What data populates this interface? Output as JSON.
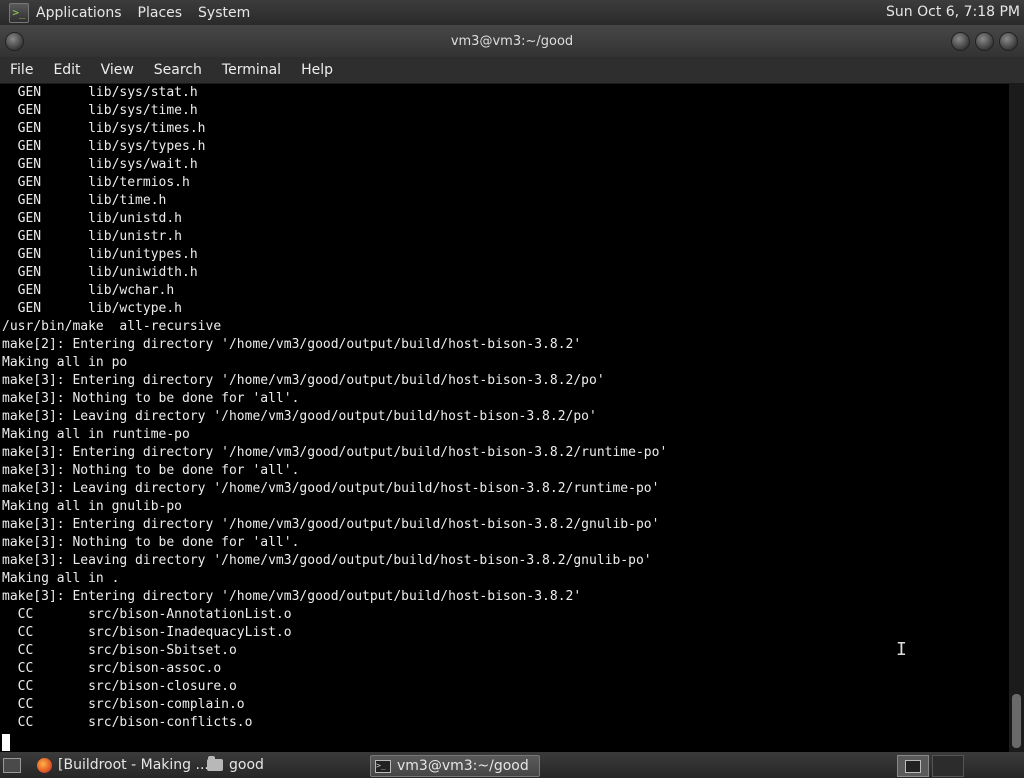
{
  "top_panel": {
    "menus": [
      "Applications",
      "Places",
      "System"
    ],
    "clock": "Sun Oct  6,  7:18 PM"
  },
  "window": {
    "title": "vm3@vm3:~/good"
  },
  "menubar": [
    "File",
    "Edit",
    "View",
    "Search",
    "Terminal",
    "Help"
  ],
  "terminal": {
    "lines": [
      "  GEN      lib/sys/stat.h",
      "  GEN      lib/sys/time.h",
      "  GEN      lib/sys/times.h",
      "  GEN      lib/sys/types.h",
      "  GEN      lib/sys/wait.h",
      "  GEN      lib/termios.h",
      "  GEN      lib/time.h",
      "  GEN      lib/unistd.h",
      "  GEN      lib/unistr.h",
      "  GEN      lib/unitypes.h",
      "  GEN      lib/uniwidth.h",
      "  GEN      lib/wchar.h",
      "  GEN      lib/wctype.h",
      "/usr/bin/make  all-recursive",
      "make[2]: Entering directory '/home/vm3/good/output/build/host-bison-3.8.2'",
      "Making all in po",
      "make[3]: Entering directory '/home/vm3/good/output/build/host-bison-3.8.2/po'",
      "make[3]: Nothing to be done for 'all'.",
      "make[3]: Leaving directory '/home/vm3/good/output/build/host-bison-3.8.2/po'",
      "Making all in runtime-po",
      "make[3]: Entering directory '/home/vm3/good/output/build/host-bison-3.8.2/runtime-po'",
      "make[3]: Nothing to be done for 'all'.",
      "make[3]: Leaving directory '/home/vm3/good/output/build/host-bison-3.8.2/runtime-po'",
      "Making all in gnulib-po",
      "make[3]: Entering directory '/home/vm3/good/output/build/host-bison-3.8.2/gnulib-po'",
      "make[3]: Nothing to be done for 'all'.",
      "make[3]: Leaving directory '/home/vm3/good/output/build/host-bison-3.8.2/gnulib-po'",
      "Making all in .",
      "make[3]: Entering directory '/home/vm3/good/output/build/host-bison-3.8.2'",
      "  CC       src/bison-AnnotationList.o",
      "  CC       src/bison-InadequacyList.o",
      "  CC       src/bison-Sbitset.o",
      "  CC       src/bison-assoc.o",
      "  CC       src/bison-closure.o",
      "  CC       src/bison-complain.o",
      "  CC       src/bison-conflicts.o"
    ]
  },
  "taskbar": {
    "tasks": [
      {
        "label": "[Buildroot - Making ...",
        "icon": "firefox-icon"
      },
      {
        "label": "good",
        "icon": "folder-icon"
      },
      {
        "label": "vm3@vm3:~/good",
        "icon": "terminal-icon"
      }
    ]
  }
}
